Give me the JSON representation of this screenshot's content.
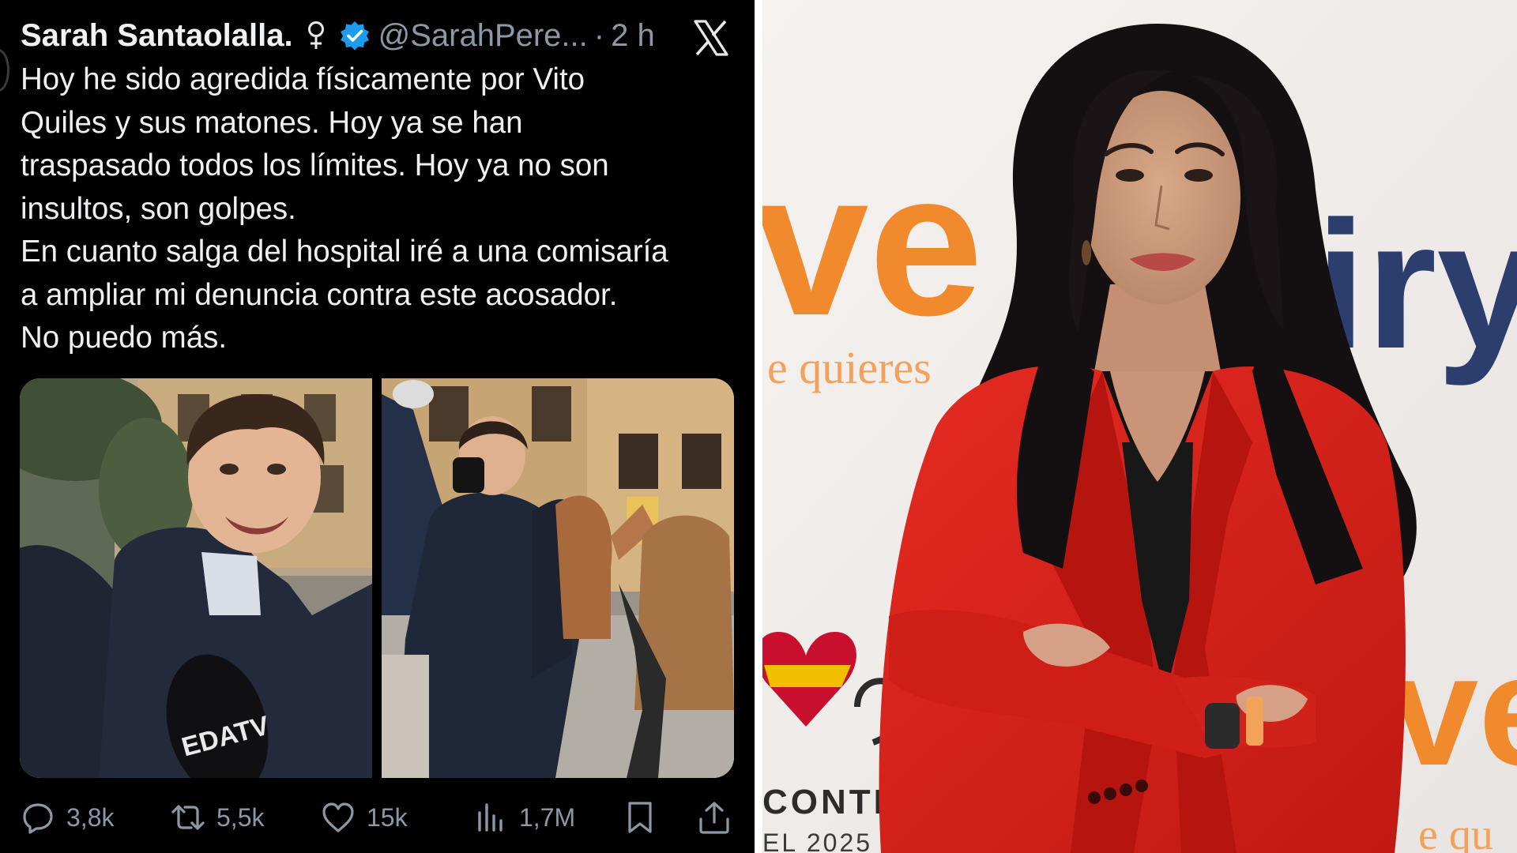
{
  "tweet": {
    "display_name": "Sarah Santaolalla.",
    "handle": "@SarahPere...",
    "separator": "·",
    "time": "2 h",
    "platform_logo": "x-logo",
    "lines": [
      "Hoy he sido agredida físicamente por Vito",
      "Quiles y sus matones. Hoy ya se han",
      "traspasado todos los límites. Hoy ya no son",
      "insultos, son golpes.",
      "En cuanto salga del hospital iré a una comisaría",
      "a ampliar mi denuncia contra este acosador.",
      "No puedo más."
    ],
    "media_icons": [
      "video-still-1",
      "video-still-2"
    ],
    "microphone_label": "EDATV",
    "actions": {
      "replies": "3,8k",
      "reposts": "5,5k",
      "likes": "15k",
      "views": "1,7M"
    },
    "colors": {
      "background": "#000000",
      "text": "#e7e9ea",
      "muted": "#8b98a5",
      "verified": "#1d9bf0"
    }
  },
  "photo": {
    "backdrop_logo_left": "ve",
    "backdrop_slogan": "e quieres",
    "backdrop_logo_right": "iry",
    "backdrop_logo_bottom_right": "ve",
    "backdrop_contest": "CONTES",
    "backdrop_year": "EL 2025",
    "backdrop_slogan_bottom": "e qu",
    "colors": {
      "orange": "#f08a2c",
      "navy": "#2c3e6e",
      "jacket": "#d9241e"
    }
  }
}
